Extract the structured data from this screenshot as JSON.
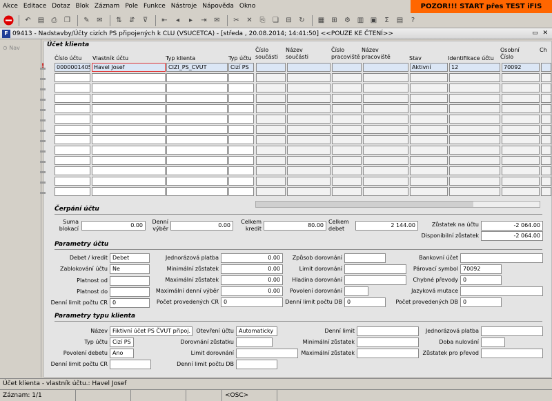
{
  "menu": [
    "Akce",
    "Editace",
    "Dotaz",
    "Blok",
    "Záznam",
    "Pole",
    "Funkce",
    "Nástroje",
    "Nápověda",
    "Okno"
  ],
  "warning": "POZOR!!!  START přes TEST iFIS",
  "window_title": "09413 - Nadstavby/Účty cizích PS připojených k CLU (VSUCETCA) - [středa , 20.08.2014; 14:41:50] <<POUZE KE ČTENÍ>>",
  "nav_label": "Nav",
  "ucet": {
    "section": "Účet klienta",
    "headers": {
      "cislo_uctu": "Číslo účtu",
      "vlastnik": "Vlastník účtu",
      "typ_klienta": "Typ klienta",
      "typ_uctu": "Typ účtu",
      "cislo_soucasti": "Číslo součásti",
      "nazev_soucasti": "Název součásti",
      "cislo_pracoviste": "Číslo pracoviště",
      "nazev_pracoviste": "Název pracoviště",
      "stav": "Stav",
      "identifikace": "Identifikace účtu",
      "osobni_cislo": "Osobní Číslo",
      "ch": "Ch"
    },
    "row": {
      "cislo_uctu": "0000001405",
      "vlastnik": "Havel Josef",
      "typ_klienta": "CIZI_PS_CVUT",
      "typ_uctu": "Cizí PS",
      "stav": "Aktivní",
      "identifikace": "12",
      "osobni_cislo": "70092"
    }
  },
  "cerpani": {
    "section": "Čerpání účtu",
    "suma_label": "Suma blokací",
    "suma": "0.00",
    "denni_label": "Denní výběr",
    "denni": "0.00",
    "kredit_label": "Celkem kredit",
    "kredit": "80.00",
    "debet_label": "Celkem debet",
    "debet": "2 144.00",
    "zustatek_label": "Zůstatek na účtu",
    "zustatek": "-2 064.00",
    "disponibilni_label": "Disponibilní zůstatek",
    "disponibilni": "-2 064.00"
  },
  "parametry": {
    "section": "Parametry účtu",
    "debet_kredit_label": "Debet / kredit",
    "debet_kredit": "Debet",
    "zablokovani_label": "Zablokování účtu",
    "zablokovani": "Ne",
    "platnost_od_label": "Platnost od",
    "platnost_do_label": "Platnost do",
    "denni_limit_cr_label": "Denní limit počtu CR",
    "denni_limit_cr": "0",
    "jednorazova_label": "Jednorázová platba",
    "jednorazova": "0.00",
    "min_zustatek_label": "Minimální zůstatek",
    "min_zustatek": "0.00",
    "max_zustatek_label": "Maximální zůstatek",
    "max_zustatek": "0.00",
    "max_denni_label": "Maximální denní výběr",
    "max_denni": "0.00",
    "pocet_cr_label": "Počet provedených CR",
    "pocet_cr": "0",
    "zpusob_label": "Způsob dorovnání",
    "limit_dor_label": "Limit dorovnání",
    "hladina_label": "Hladina dorovnání",
    "povoleni_dor_label": "Povolení dorovnání",
    "denni_limit_db_label": "Denní limit počtu DB",
    "denni_limit_db": "0",
    "bankovni_label": "Bankovní účet",
    "parovaci_label": "Párovací symbol",
    "parovaci": "70092",
    "chybne_label": "Chybné převody",
    "chybne": "0",
    "jazykova_label": "Jazyková mutace",
    "pocet_db_label": "Počet provedených DB",
    "pocet_db": "0"
  },
  "typ": {
    "section": "Parametry typu klienta",
    "nazev_label": "Název",
    "nazev": "Fiktivní účet  PS ČVUT připoj. k",
    "typ_uctu_label": "Typ účtu",
    "typ_uctu": "Cizí PS",
    "povoleni_label": "Povolení debetu",
    "povoleni": "Ano",
    "denni_cr_label": "Denní limit počtu CR",
    "otevreni_label": "Otevření účtu",
    "otevreni": "Automaticky",
    "dorovnani_label": "Dorovnání zůstatku",
    "limit_dor_label": "Limit dorovnání",
    "denni_db_label": "Denní limit počtu DB",
    "denni_limit_label": "Denní limit",
    "min_label": "Minimální zůstatek",
    "max_label": "Maximální zůstatek",
    "jednorazova_label": "Jednorázová platba",
    "doba_label": "Doba nulování",
    "zustatek_prevod_label": "Zůstatek pro převod"
  },
  "status": {
    "message": "Účet klienta - vlastník účtu.: Havel Josef",
    "record": "Záznam: 1/1",
    "mode": "<OSC>"
  }
}
